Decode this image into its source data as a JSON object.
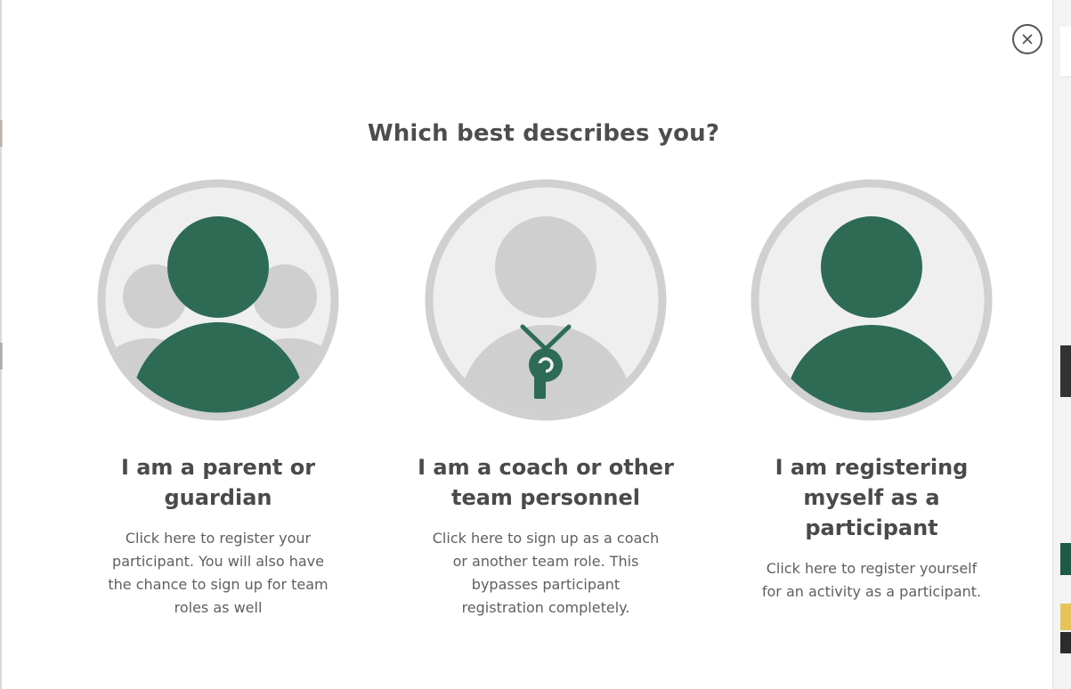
{
  "dialog": {
    "title": "Which best describes you?",
    "close_icon": "close-icon"
  },
  "options": [
    {
      "heading": "I am a parent or guardian",
      "description": "Click here to register your participant. You will also have the chance to sign up for team roles as well",
      "icon": "family-avatar-icon"
    },
    {
      "heading": "I am a coach or other team personnel",
      "description": "Click here to sign up as a coach or another team role. This bypasses participant registration completely.",
      "icon": "coach-whistle-avatar-icon"
    },
    {
      "heading": "I am registering myself as a participant",
      "description": "Click here to register yourself for an activity as a participant.",
      "icon": "participant-avatar-icon"
    }
  ],
  "colors": {
    "accent": "#2d6b55",
    "avatar_bg": "#efefef",
    "avatar_ring": "#d0d0d0",
    "silhouette_gray": "#cccccc"
  }
}
